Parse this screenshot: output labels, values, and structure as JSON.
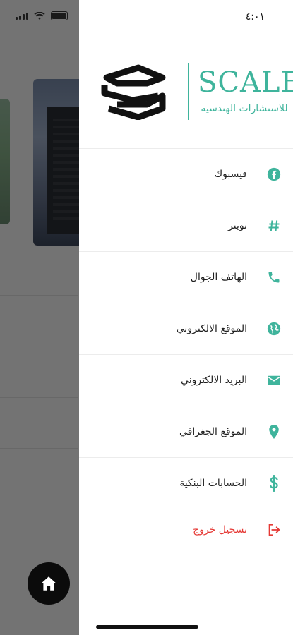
{
  "status_bar": {
    "time": "٤:٠١"
  },
  "brand": {
    "name": "SCALE",
    "subtitle": "للاستشارات الهندسية"
  },
  "menu": {
    "items": [
      {
        "label": "فيسبوك",
        "icon": "facebook-icon"
      },
      {
        "label": "تويتر",
        "icon": "hashtag-icon"
      },
      {
        "label": "الهاتف الجوال",
        "icon": "phone-icon"
      },
      {
        "label": "الموقع الالكتروني",
        "icon": "globe-icon"
      },
      {
        "label": "البريد الالكتروني",
        "icon": "mail-icon"
      },
      {
        "label": "الموقع الجغرافي",
        "icon": "location-pin-icon"
      },
      {
        "label": "الحسابات البنكية",
        "icon": "dollar-icon"
      }
    ],
    "logout": {
      "label": "تسجيل خروج",
      "icon": "logout-icon"
    }
  },
  "colors": {
    "accent": "#3fb49c",
    "logout": "#e53935",
    "overlay": "rgba(0,0,0,0.55)"
  }
}
